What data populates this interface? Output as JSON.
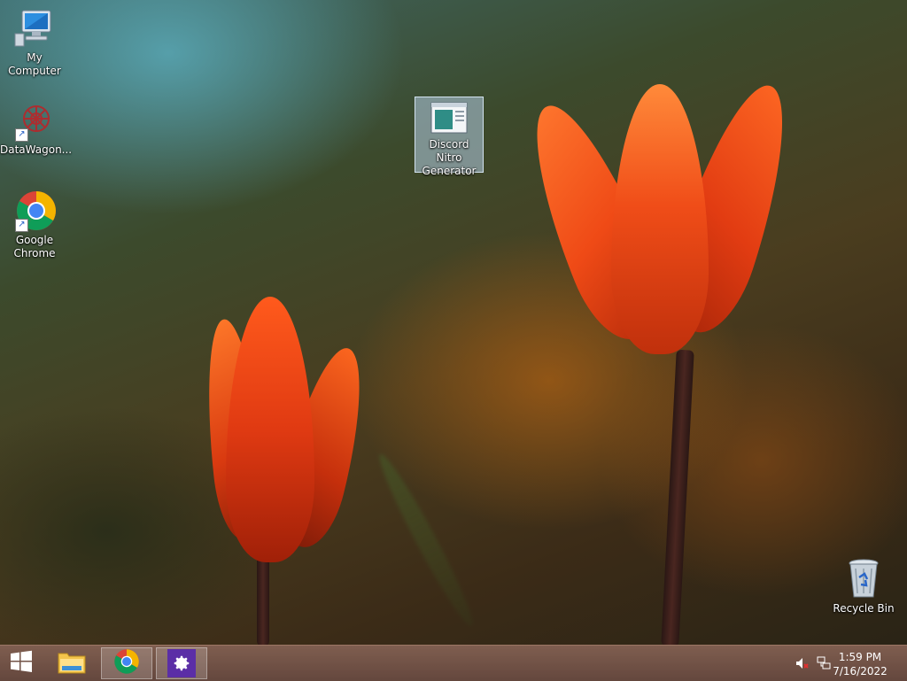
{
  "desktop": {
    "icons": [
      {
        "label": "My Computer",
        "icon": "computer-icon"
      },
      {
        "label": "DataWagon...",
        "icon": "datawagon-icon",
        "shortcut": true
      },
      {
        "label": "Google Chrome",
        "icon": "chrome-icon",
        "shortcut": true
      },
      {
        "label": "Discord Nitro Generator",
        "icon": "application-window-icon",
        "selected": true
      },
      {
        "label": "Recycle Bin",
        "icon": "recycle-bin-icon"
      }
    ]
  },
  "taskbar": {
    "start_icon": "windows-logo-icon",
    "pinned": [
      {
        "icon": "file-explorer-icon"
      },
      {
        "icon": "chrome-icon"
      },
      {
        "icon": "settings-gear-icon"
      }
    ],
    "tray": {
      "volume_icon": "volume-muted-icon",
      "network_icon": "network-icon"
    },
    "clock": {
      "time": "1:59 PM",
      "date": "7/16/2022"
    }
  },
  "colors": {
    "taskbar": "#6e4d40",
    "selection": "#b4cde6",
    "settings_tile": "#5b2ea6"
  }
}
